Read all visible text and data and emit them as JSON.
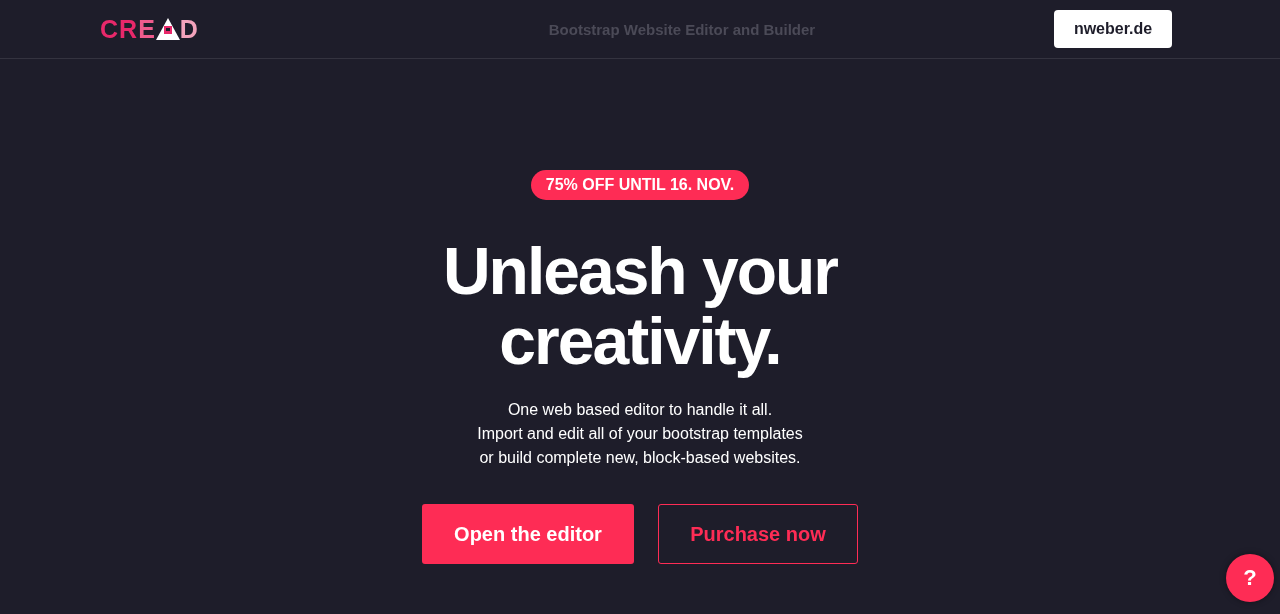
{
  "header": {
    "logo": {
      "start": "CRE",
      "end": "D"
    },
    "tagline": "Bootstrap Website Editor and Builder",
    "account_button": "nweber.de"
  },
  "hero": {
    "badge": "75% OFF UNTIL 16. NOV.",
    "heading_lines": [
      "Unleash your",
      "creativity."
    ],
    "description_lines": [
      "One web based editor to handle it all.",
      "Import and edit all of your bootstrap templates",
      "or build complete new, block-based websites."
    ],
    "buttons": [
      {
        "label": "Open the editor",
        "kind": "primary"
      },
      {
        "label": "Purchase now",
        "kind": "outline"
      }
    ]
  },
  "help_button": "?"
}
